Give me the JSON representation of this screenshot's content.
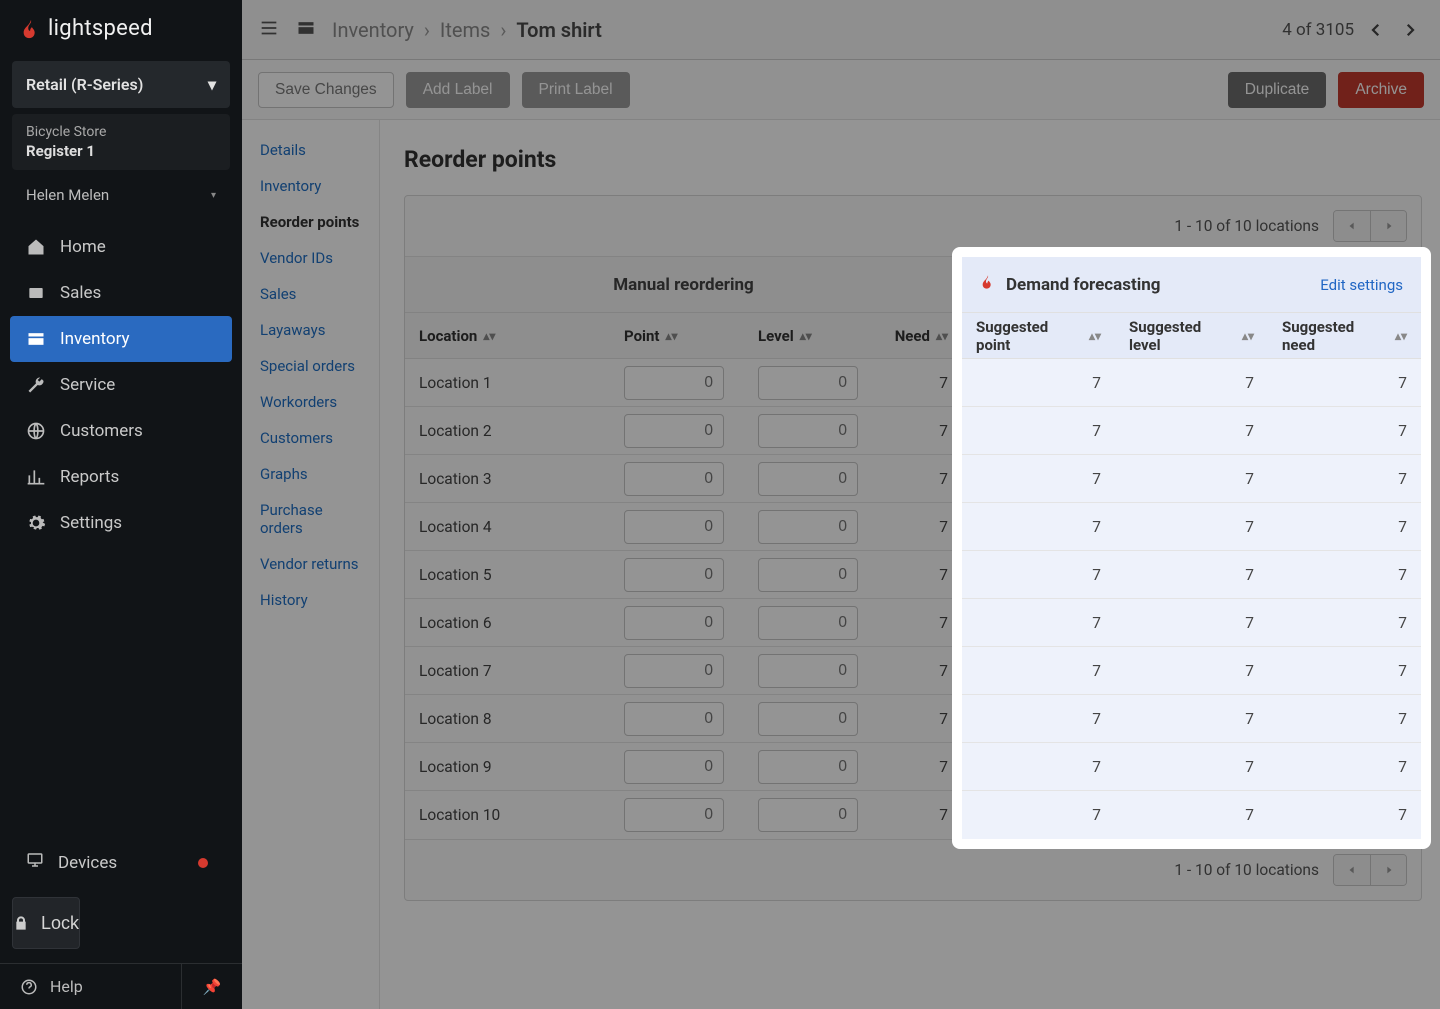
{
  "brand": "lightspeed",
  "series": "Retail (R-Series)",
  "store": {
    "name": "Bicycle Store",
    "register": "Register 1"
  },
  "user": "Helen Melen",
  "nav": {
    "home": "Home",
    "sales": "Sales",
    "inventory": "Inventory",
    "service": "Service",
    "customers": "Customers",
    "reports": "Reports",
    "settings": "Settings",
    "devices": "Devices",
    "lock": "Lock",
    "help": "Help"
  },
  "breadcrumb": {
    "l1": "Inventory",
    "l2": "Items",
    "l3": "Tom shirt"
  },
  "topPager": {
    "text": "4 of 3105"
  },
  "actions": {
    "save": "Save Changes",
    "addLabel": "Add Label",
    "printLabel": "Print Label",
    "duplicate": "Duplicate",
    "archive": "Archive"
  },
  "subnav": [
    "Details",
    "Inventory",
    "Reorder points",
    "Vendor IDs",
    "Sales",
    "Layaways",
    "Special orders",
    "Workorders",
    "Customers",
    "Graphs",
    "Purchase orders",
    "Vendor returns",
    "History"
  ],
  "subnavActive": "Reorder points",
  "page": {
    "title": "Reorder points",
    "pagerText": "1 - 10  of 10 locations",
    "manualTitle": "Manual reordering",
    "forecastTitle": "Demand forecasting",
    "editSettings": "Edit settings",
    "cols": {
      "location": "Location",
      "point": "Point",
      "level": "Level",
      "need": "Need",
      "sPoint": "Suggested point",
      "sLevel": "Suggested level",
      "sNeed": "Suggested need"
    },
    "rows": [
      {
        "loc": "Location 1",
        "point": "0",
        "level": "0",
        "need": "7",
        "sp": "7",
        "sl": "7",
        "sn": "7"
      },
      {
        "loc": "Location 2",
        "point": "0",
        "level": "0",
        "need": "7",
        "sp": "7",
        "sl": "7",
        "sn": "7"
      },
      {
        "loc": "Location 3",
        "point": "0",
        "level": "0",
        "need": "7",
        "sp": "7",
        "sl": "7",
        "sn": "7"
      },
      {
        "loc": "Location 4",
        "point": "0",
        "level": "0",
        "need": "7",
        "sp": "7",
        "sl": "7",
        "sn": "7"
      },
      {
        "loc": "Location 5",
        "point": "0",
        "level": "0",
        "need": "7",
        "sp": "7",
        "sl": "7",
        "sn": "7"
      },
      {
        "loc": "Location 6",
        "point": "0",
        "level": "0",
        "need": "7",
        "sp": "7",
        "sl": "7",
        "sn": "7"
      },
      {
        "loc": "Location 7",
        "point": "0",
        "level": "0",
        "need": "7",
        "sp": "7",
        "sl": "7",
        "sn": "7"
      },
      {
        "loc": "Location 8",
        "point": "0",
        "level": "0",
        "need": "7",
        "sp": "7",
        "sl": "7",
        "sn": "7"
      },
      {
        "loc": "Location 9",
        "point": "0",
        "level": "0",
        "need": "7",
        "sp": "7",
        "sl": "7",
        "sn": "7"
      },
      {
        "loc": "Location 10",
        "point": "0",
        "level": "0",
        "need": "7",
        "sp": "7",
        "sl": "7",
        "sn": "7"
      }
    ]
  }
}
